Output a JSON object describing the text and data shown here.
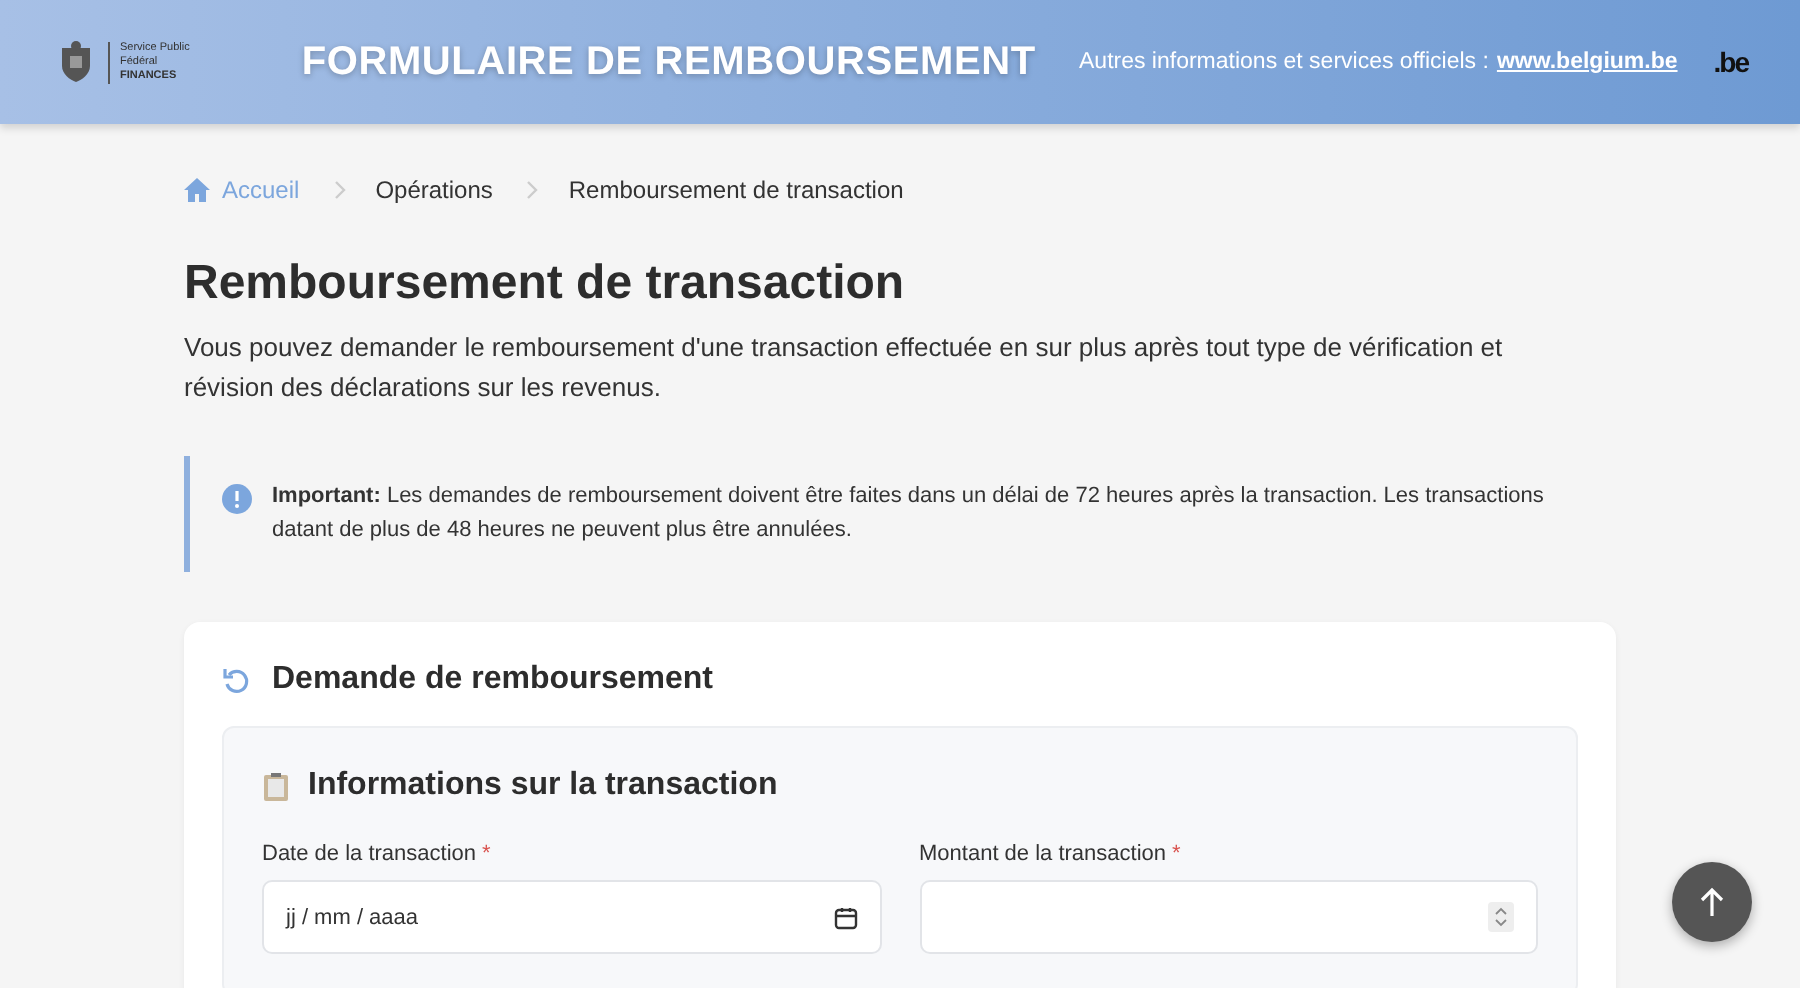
{
  "header": {
    "logo_lines": [
      "Service Public",
      "Fédéral",
      "FINANCES"
    ],
    "title": "FORMULAIRE DE REMBOURSEMENT",
    "info_text": "Autres informations et services officiels :",
    "info_link": "www.belgium.be",
    "be_logo": ".be"
  },
  "breadcrumb": [
    {
      "label": "Accueil",
      "kind": "home"
    },
    {
      "label": "Opérations",
      "kind": "item"
    },
    {
      "label": "Remboursement de transaction",
      "kind": "current"
    }
  ],
  "page_title": "Remboursement de transaction",
  "intro": "Vous pouvez demander le remboursement d'une transaction effectuée en sur plus après tout type de vérification et révision des déclarations sur les revenus.",
  "alert": {
    "text": "**Important:** Les demandes de remboursement doivent être faites dans un délai de 72 heures après la transaction. Les transactions datant de plus de 48 heures ne peuvent plus être annulées."
  },
  "card": {
    "title": "Demande de remboursement",
    "section": {
      "title": "Informations sur la transaction",
      "fields": [
        {
          "label": "Date de la transaction",
          "required_mark": "*",
          "kind": "date",
          "placeholder": "jj / mm / aaaa"
        },
        {
          "label": "Montant de la transaction",
          "required_mark": "*",
          "kind": "number"
        }
      ]
    }
  }
}
